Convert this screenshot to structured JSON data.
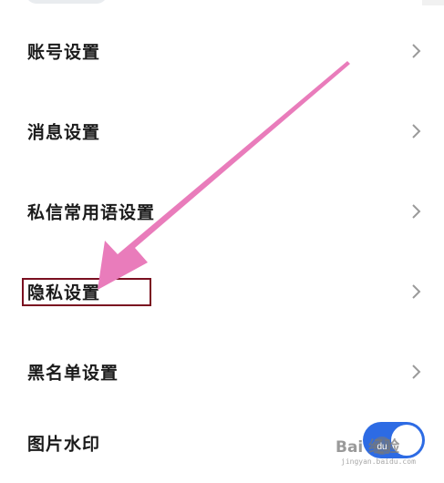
{
  "settings": {
    "items": [
      {
        "label": "账号设置",
        "chevron": "chevron-right-icon"
      },
      {
        "label": "消息设置",
        "chevron": "chevron-right-icon"
      },
      {
        "label": "私信常用语设置",
        "chevron": "chevron-right-icon"
      },
      {
        "label": "隐私设置",
        "chevron": "chevron-right-icon"
      },
      {
        "label": "黑名单设置",
        "chevron": "chevron-right-icon"
      },
      {
        "label": "图片水印",
        "toggle": "on"
      }
    ]
  },
  "annotation": {
    "arrow_color": "#e97cbb",
    "highlight_color": "#7a1020",
    "highlighted_item": "隐私设置"
  },
  "watermark": {
    "brand": "Bai  经验",
    "brand_mark": "du",
    "url": "jingyan.baidu.com"
  },
  "colors": {
    "toggle_on": "#2d6be4",
    "text": "#1b1b1b",
    "chevron": "#9a9a9a"
  }
}
